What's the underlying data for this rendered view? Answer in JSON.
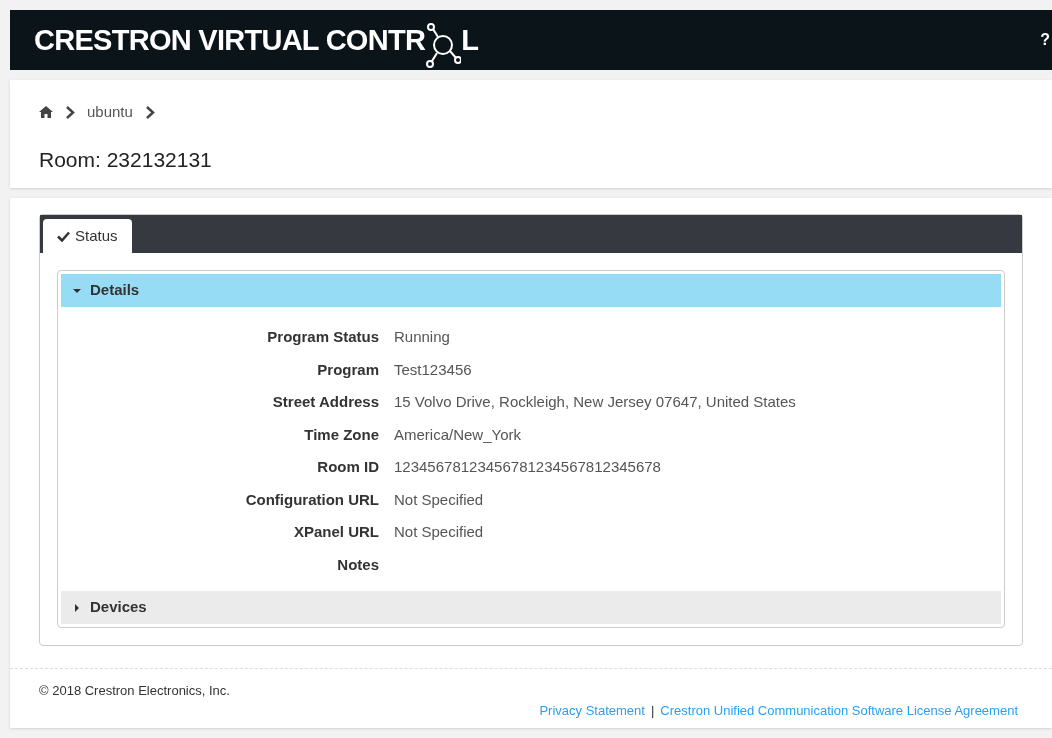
{
  "header": {
    "logo_start": "CRESTRON VIRTUAL CONTR",
    "logo_end": "L",
    "help": "?"
  },
  "breadcrumb": [
    "ubuntu"
  ],
  "page_title": "Room: 232132131",
  "tabs": [
    {
      "label": "Status",
      "selected": true
    }
  ],
  "sections": [
    {
      "title": "Details",
      "expanded": true,
      "fields": [
        {
          "label": "Program Status",
          "value": "Running"
        },
        {
          "label": "Program",
          "value": "Test123456"
        },
        {
          "label": "Street Address",
          "value": "15 Volvo Drive, Rockleigh, New Jersey 07647, United States"
        },
        {
          "label": "Time Zone",
          "value": "America/New_York"
        },
        {
          "label": "Room ID",
          "value": "12345678123456781234567812345678"
        },
        {
          "label": "Configuration URL",
          "value": "Not Specified"
        },
        {
          "label": "XPanel URL",
          "value": "Not Specified"
        },
        {
          "label": "Notes"
        }
      ]
    },
    {
      "title": "Devices",
      "expanded": false
    }
  ],
  "footer": {
    "copyright": "© 2018 Crestron Electronics, Inc.",
    "links": [
      "Privacy Statement",
      "Crestron Unified Communication Software License Agreement"
    ],
    "separator": "|"
  }
}
